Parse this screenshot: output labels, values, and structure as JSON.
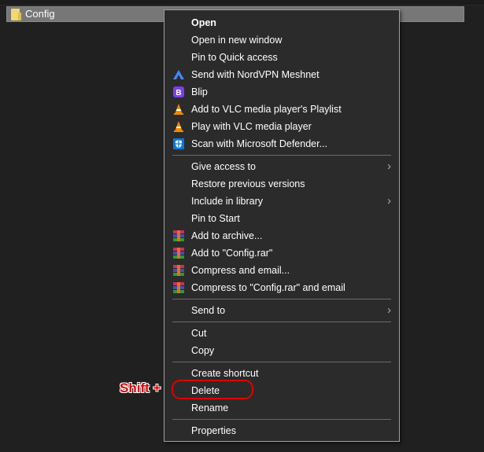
{
  "explorer": {
    "selected_item": "Config"
  },
  "colors": {
    "accent_red": "#e00000",
    "menu_bg": "#2b2b2b"
  },
  "menu": {
    "items": [
      {
        "label": "Open",
        "bold": true
      },
      {
        "label": "Open in new window"
      },
      {
        "label": "Pin to Quick access"
      },
      {
        "label": "Send with NordVPN Meshnet",
        "icon": "nordvpn-icon"
      },
      {
        "label": "Blip",
        "icon": "blip-icon"
      },
      {
        "label": "Add to VLC media player's Playlist",
        "icon": "vlc-icon"
      },
      {
        "label": "Play with VLC media player",
        "icon": "vlc-icon"
      },
      {
        "label": "Scan with Microsoft Defender...",
        "icon": "defender-icon"
      },
      {
        "separator": true
      },
      {
        "label": "Give access to",
        "submenu": true
      },
      {
        "label": "Restore previous versions"
      },
      {
        "label": "Include in library",
        "submenu": true
      },
      {
        "label": "Pin to Start"
      },
      {
        "label": "Add to archive...",
        "icon": "winrar-icon"
      },
      {
        "label": "Add to \"Config.rar\"",
        "icon": "winrar-icon"
      },
      {
        "label": "Compress and email...",
        "icon": "winrar-icon"
      },
      {
        "label": "Compress to \"Config.rar\" and email",
        "icon": "winrar-icon"
      },
      {
        "separator": true
      },
      {
        "label": "Send to",
        "submenu": true
      },
      {
        "separator": true
      },
      {
        "label": "Cut"
      },
      {
        "label": "Copy"
      },
      {
        "separator": true
      },
      {
        "label": "Create shortcut"
      },
      {
        "label": "Delete"
      },
      {
        "label": "Rename"
      },
      {
        "separator": true
      },
      {
        "label": "Properties"
      }
    ]
  },
  "annotation": {
    "text": "Shift +"
  }
}
